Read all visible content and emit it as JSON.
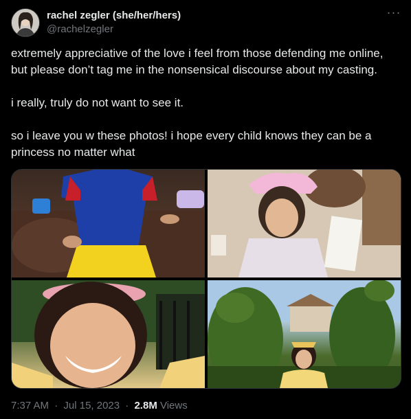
{
  "author": {
    "display_name": "rachel zegler (she/her/hers)",
    "handle": "@rachelzegler",
    "avatar_icon": "profile-photo"
  },
  "more_icon": "···",
  "body": {
    "paragraphs": [
      "extremely appreciative of the love i feel from those defending me online, but please don’t tag me in the nonsensical discourse about my casting.",
      "i really, truly do not want to see it.",
      "so i leave you w these photos! i hope every child knows they can be a princess no matter what"
    ]
  },
  "media": {
    "photos": [
      {
        "subject": "child in snow white costume"
      },
      {
        "subject": "child in tiara holding paper"
      },
      {
        "subject": "smiling child with flower crown"
      },
      {
        "subject": "child in belle dress with topiaries"
      }
    ]
  },
  "meta": {
    "time": "7:37 AM",
    "separator": "·",
    "date": "Jul 15, 2023",
    "views_count": "2.8M",
    "views_label": " Views"
  },
  "colors": {
    "background": "#000000",
    "text_primary": "#e7e9ea",
    "text_secondary": "#71767b",
    "border": "#2f3336"
  }
}
